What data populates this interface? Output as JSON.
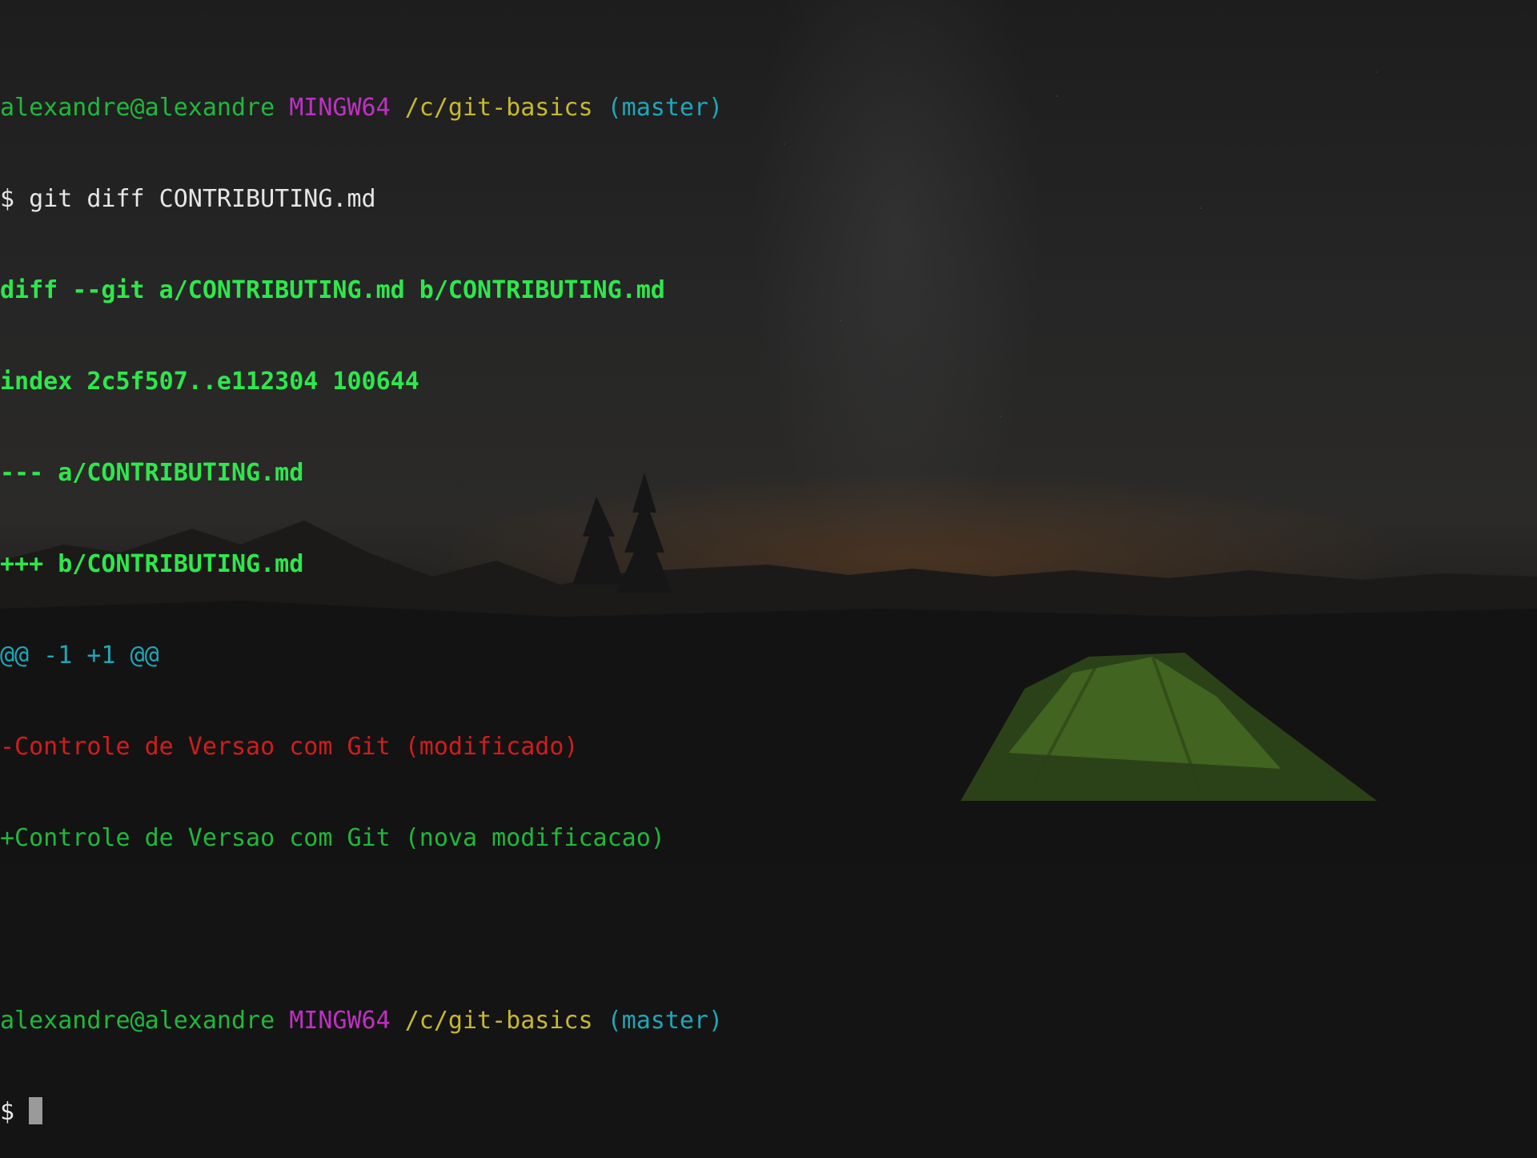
{
  "terminal": {
    "prompt1": {
      "user_host": "alexandre@alexandre",
      "shell": "MINGW64",
      "path": "/c/git-basics",
      "branch": "(master)"
    },
    "command_line": {
      "prompt_symbol": "$",
      "command": "git diff CONTRIBUTING.md"
    },
    "diff": {
      "header": "diff --git a/CONTRIBUTING.md b/CONTRIBUTING.md",
      "index": "index 2c5f507..e112304 100644",
      "old_file": "--- a/CONTRIBUTING.md",
      "new_file": "+++ b/CONTRIBUTING.md",
      "hunk": "@@ -1 +1 @@",
      "removed": "-Controle de Versao com Git (modificado)",
      "added": "+Controle de Versao com Git (nova modificacao)"
    },
    "prompt2": {
      "user_host": "alexandre@alexandre",
      "shell": "MINGW64",
      "path": "/c/git-basics",
      "branch": "(master)"
    },
    "input_line": {
      "prompt_symbol": "$"
    }
  },
  "colors": {
    "user_host": "#1fb83c",
    "diff_header": "#2ee74c",
    "shell": "#c030c4",
    "path": "#c8b830",
    "branch": "#1fa6b8",
    "removed": "#d21c1c",
    "added": "#1fb83c"
  },
  "icons": {
    "cursor": "block-cursor-icon",
    "wallpaper": "night-camping-wallpaper"
  }
}
